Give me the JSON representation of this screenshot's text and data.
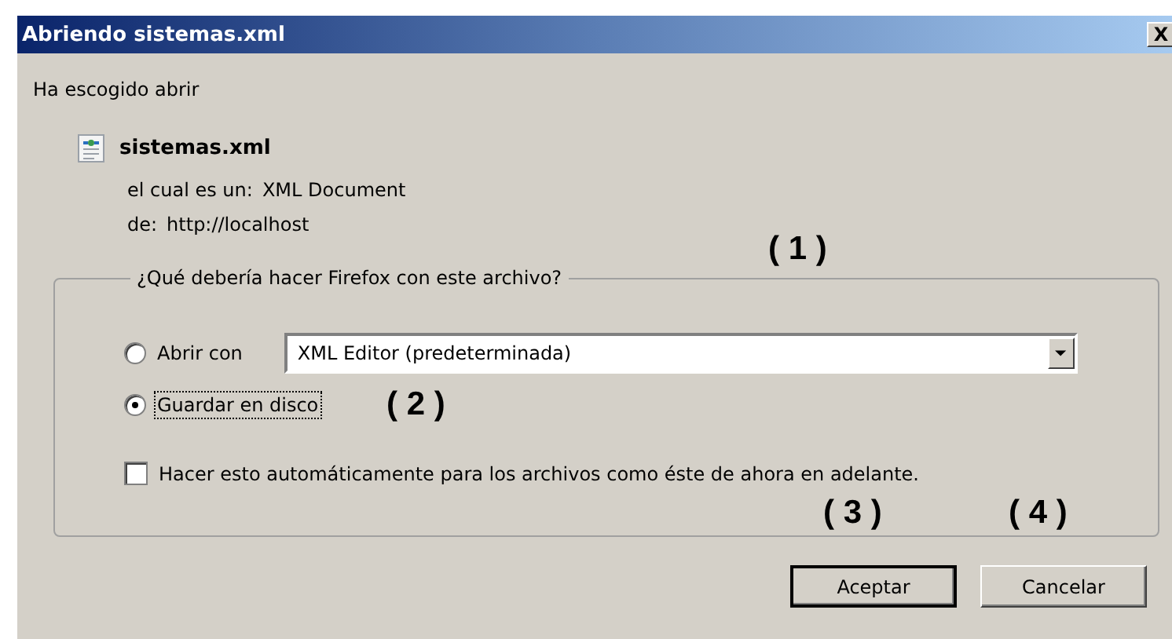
{
  "window": {
    "title": "Abriendo sistemas.xml",
    "close": "X"
  },
  "intro": "Ha escogido abrir",
  "file": {
    "name": "sistemas.xml",
    "type_label": "el cual es un:",
    "type_value": "XML Document",
    "from_label": "de:",
    "from_value": "http://localhost"
  },
  "group": {
    "legend": "¿Qué debería hacer Firefox con este archivo?",
    "options": [
      {
        "label": "Abrir con",
        "selected": false,
        "focused": false,
        "select": "XML Editor (predeterminada)"
      },
      {
        "label": "Guardar en disco",
        "selected": true,
        "focused": true
      }
    ],
    "checkbox": {
      "label": "Hacer esto automáticamente para los archivos como éste de ahora en adelante.",
      "checked": false
    }
  },
  "buttons": [
    {
      "label": "Aceptar",
      "default": true
    },
    {
      "label": "Cancelar",
      "default": false
    }
  ],
  "annotations": [
    "( 1 )",
    "( 2 )",
    "( 3 )",
    "( 4 )"
  ]
}
